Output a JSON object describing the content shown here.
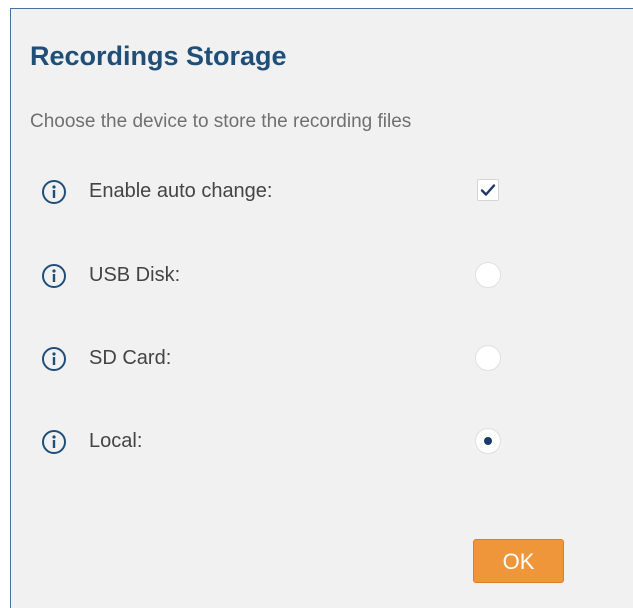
{
  "dialog": {
    "title": "Recordings Storage",
    "subtitle": "Choose the device to store the recording files"
  },
  "options": [
    {
      "label": "Enable auto change:",
      "control": "checkbox",
      "checked": true
    },
    {
      "label": "USB Disk:",
      "control": "radio",
      "checked": false
    },
    {
      "label": "SD Card:",
      "control": "radio",
      "checked": false
    },
    {
      "label": "Local:",
      "control": "radio",
      "checked": true
    }
  ],
  "ok_label": "OK",
  "colors": {
    "title": "#1f4e79",
    "accent_button": "#f0963a",
    "info_icon": "#1f4e79",
    "radio_selected": "#1a3a6b"
  },
  "icons": {
    "info": "info-circle-icon",
    "check": "checkmark-icon"
  }
}
